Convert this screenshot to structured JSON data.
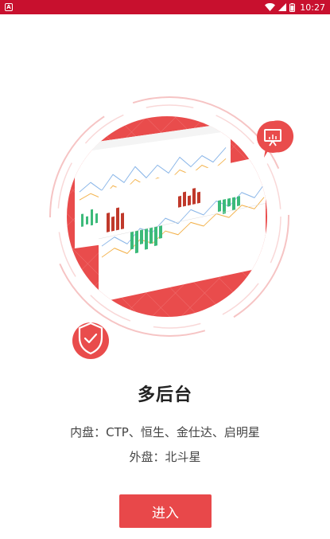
{
  "status_bar": {
    "time": "10:27",
    "battery_icon": "battery-icon",
    "wifi_icon": "wifi-icon",
    "signal_icon": "signal-icon",
    "app_icon": "app-notification-icon"
  },
  "colors": {
    "status_bar": "#c8102e",
    "accent": "#e8484a",
    "title": "#222222",
    "text": "#444444"
  },
  "illustration": {
    "icons": [
      "presentation-chart-icon",
      "shield-check-icon"
    ]
  },
  "onboarding": {
    "title": "多后台",
    "line1": "内盘：CTP、恒生、金仕达、启明星",
    "line2": "外盘：北斗星",
    "enter_label": "进入"
  }
}
